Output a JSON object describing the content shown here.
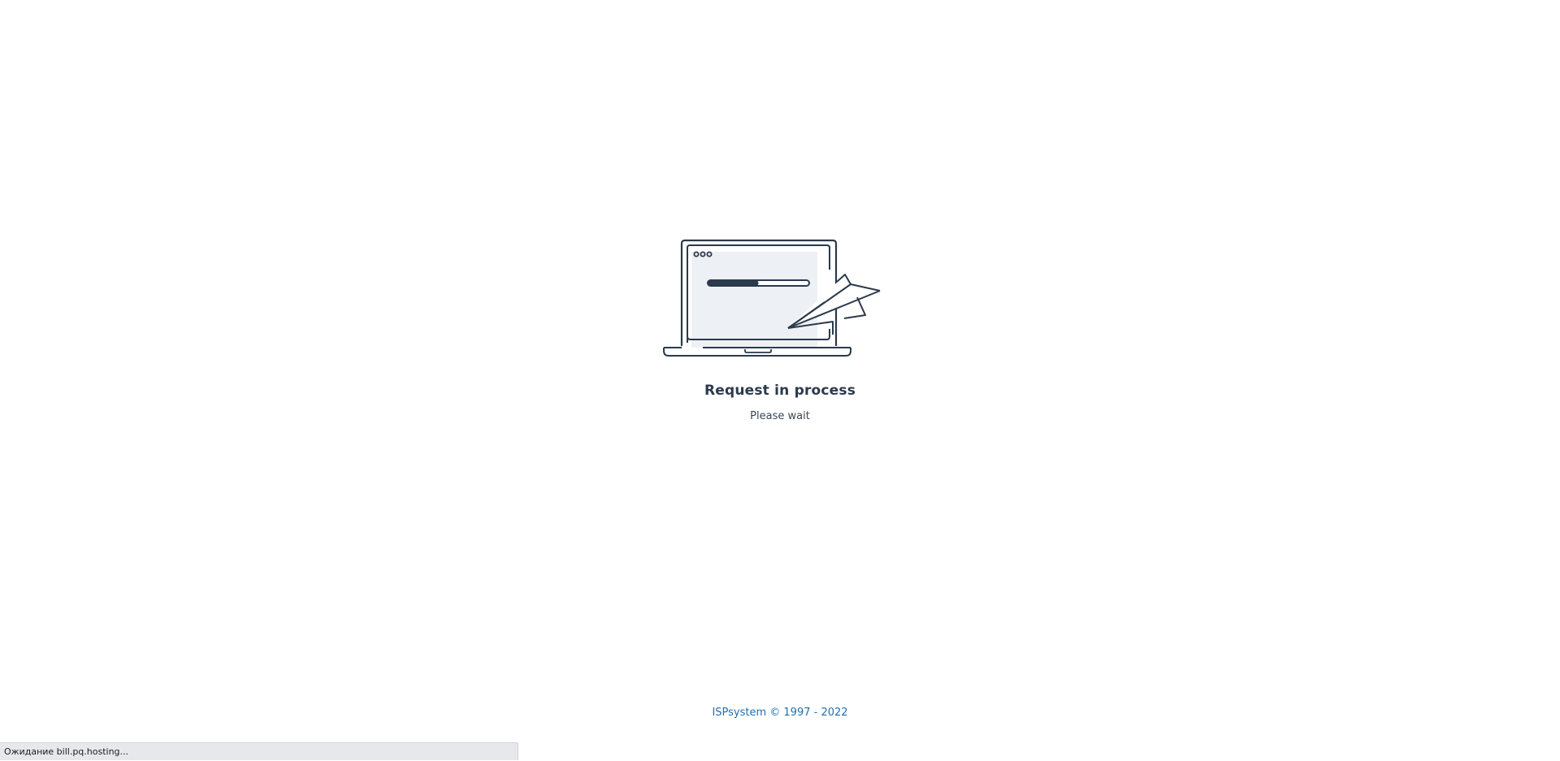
{
  "loader": {
    "title": "Request in process",
    "subtitle": "Please wait",
    "illustration_icon": "laptop-paper-plane-icon",
    "progress_fraction": 0.5
  },
  "footer": {
    "brand": "ISPsystem",
    "copyright": "© 1997 - 2022"
  },
  "status_bar": {
    "text": "Ожидание bill.pq.hosting..."
  },
  "colors": {
    "ink": "#2b3a4c",
    "screen_fill": "#edf1f5",
    "link": "#1f6fae",
    "status_bg": "#e6e8ec"
  }
}
